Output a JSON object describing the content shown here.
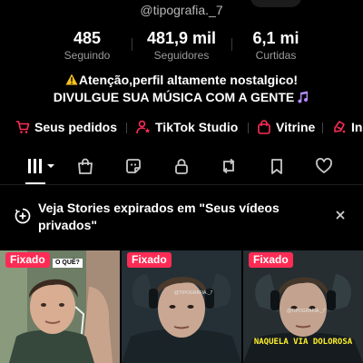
{
  "profile": {
    "username": "@tipografia._7"
  },
  "stats": [
    {
      "value": "485",
      "label": "Seguindo"
    },
    {
      "value": "481,9 mil",
      "label": "Seguidores"
    },
    {
      "value": "6,1 mi",
      "label": "Curtidas"
    }
  ],
  "bio": {
    "line1": "Atenção,perfil altamente nostalgico!",
    "line2": "DIVULGUE SUA MÚSICA COM A GENTE"
  },
  "links": [
    {
      "label": "Seus pedidos",
      "icon": "cart-icon"
    },
    {
      "label": "TikTok Studio",
      "icon": "studio-person-icon"
    },
    {
      "label": "Vitrine",
      "icon": "shopping-bag-icon"
    },
    {
      "label": "In",
      "icon": "promote-icon"
    }
  ],
  "tabs": [
    {
      "name": "videos",
      "icon": "grid-icon",
      "active": true
    },
    {
      "name": "shop",
      "icon": "bag-icon"
    },
    {
      "name": "stickers",
      "icon": "sticker-icon"
    },
    {
      "name": "private",
      "icon": "lock-icon"
    },
    {
      "name": "reposts",
      "icon": "repost-icon"
    },
    {
      "name": "favorites",
      "icon": "bookmark-icon"
    },
    {
      "name": "liked",
      "icon": "heart-icon"
    }
  ],
  "banner": {
    "text": "Veja Stories expirados em \"Seus vídeos privados\""
  },
  "videos": [
    {
      "badge": "Fixado",
      "caption": "O QUÊ?"
    },
    {
      "badge": "Fixado",
      "tag": "@TIPOGRAFIA._7"
    },
    {
      "badge": "Fixado",
      "tag": "@TIPOGRAFIA._7",
      "caption": "NAQUELA VIA DOLOROSA"
    }
  ],
  "colors": {
    "background": "#000000",
    "accent_red": "#fe2c55",
    "muted_text": "#9a9a9a",
    "caption_yellow": "#fff12a"
  }
}
